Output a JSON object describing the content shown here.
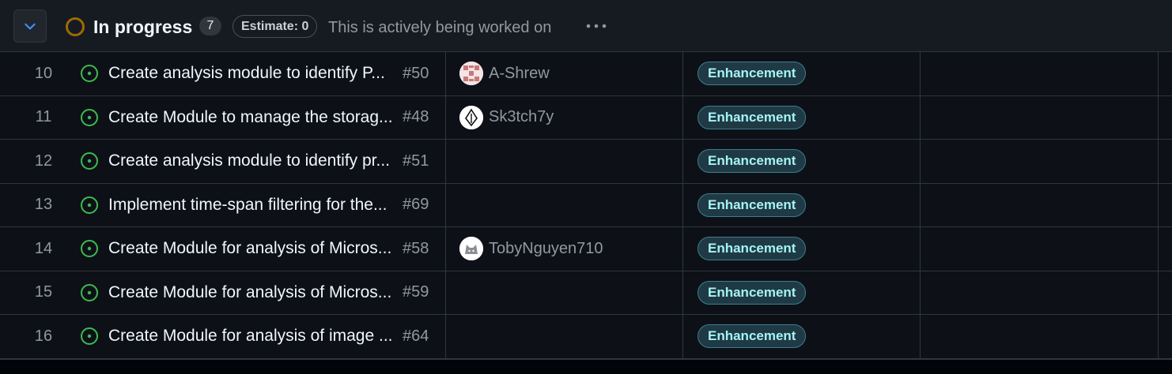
{
  "group": {
    "title": "In progress",
    "count": "7",
    "estimate": "Estimate: 0",
    "description": "This is actively being worked on",
    "collapse_icon": "chevron-down-icon",
    "more_icon": "kebab-horizontal-icon",
    "status_color": "#9e6a03"
  },
  "label_colors": {
    "background": "#1f3a45",
    "border": "#3c7e8f",
    "text": "#a5f3f5"
  },
  "rows": [
    {
      "num": "10",
      "title": "Create analysis module to identify P...",
      "number": "#50",
      "assignee": "A-Shrew",
      "avatar": "checker-avatar",
      "label": "Enhancement"
    },
    {
      "num": "11",
      "title": "Create Module to manage the storag...",
      "number": "#48",
      "assignee": "Sk3tch7y",
      "avatar": "pen-nib-avatar",
      "label": "Enhancement"
    },
    {
      "num": "12",
      "title": "Create analysis module to identify pr...",
      "number": "#51",
      "assignee": "",
      "avatar": "",
      "label": "Enhancement"
    },
    {
      "num": "13",
      "title": "Implement time-span filtering for the...",
      "number": "#69",
      "assignee": "",
      "avatar": "",
      "label": "Enhancement"
    },
    {
      "num": "14",
      "title": "Create Module for analysis of Micros...",
      "number": "#58",
      "assignee": "TobyNguyen710",
      "avatar": "cat-avatar",
      "label": "Enhancement"
    },
    {
      "num": "15",
      "title": "Create Module for analysis of Micros...",
      "number": "#59",
      "assignee": "",
      "avatar": "",
      "label": "Enhancement"
    },
    {
      "num": "16",
      "title": "Create Module for analysis of image ...",
      "number": "#64",
      "assignee": "",
      "avatar": "",
      "label": "Enhancement"
    }
  ]
}
